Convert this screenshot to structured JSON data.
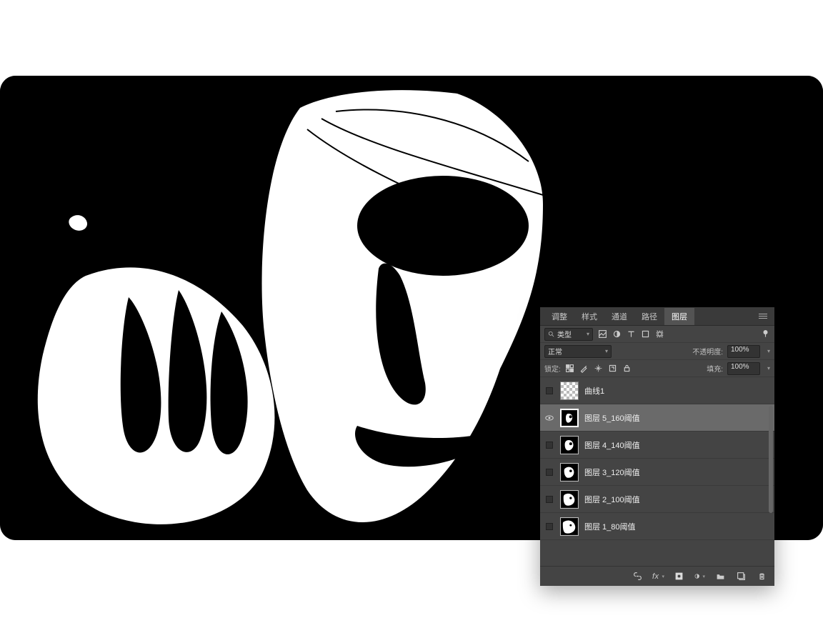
{
  "panel": {
    "tabs": [
      "调整",
      "样式",
      "通道",
      "路径",
      "图层"
    ],
    "active_tab": 4,
    "filter": {
      "mode_icon": "search",
      "type_label": "类型"
    },
    "blend": {
      "mode": "正常",
      "opacity_label": "不透明度:",
      "opacity_value": "100%"
    },
    "lock": {
      "label": "锁定:",
      "fill_label": "填充:",
      "fill_value": "100%"
    },
    "layers": [
      {
        "name": "曲线1",
        "visible": false,
        "selected": false,
        "thumb": "transparent"
      },
      {
        "name": "图层 5_160阈值",
        "visible": true,
        "selected": true,
        "thumb": "face1"
      },
      {
        "name": "图层 4_140阈值",
        "visible": false,
        "selected": false,
        "thumb": "face2"
      },
      {
        "name": "图层 3_120阈值",
        "visible": false,
        "selected": false,
        "thumb": "face3"
      },
      {
        "name": "图层 2_100阈值",
        "visible": false,
        "selected": false,
        "thumb": "face4"
      },
      {
        "name": "图层 1_80阈值",
        "visible": false,
        "selected": false,
        "thumb": "face5"
      }
    ]
  }
}
